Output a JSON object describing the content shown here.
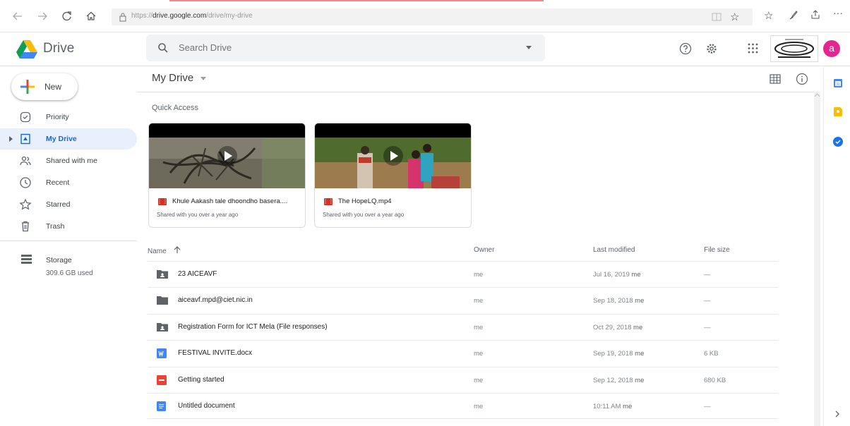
{
  "browser": {
    "url_prefix": "https://",
    "url_host": "drive.google.com",
    "url_path": "/drive/my-drive"
  },
  "header": {
    "app_title": "Drive",
    "search_placeholder": "Search Drive",
    "avatar_letter": "a"
  },
  "sidebar": {
    "new_label": "New",
    "items": [
      {
        "label": "Priority",
        "icon": "check-circle-icon"
      },
      {
        "label": "My Drive",
        "icon": "drive-folder-icon",
        "active": true
      },
      {
        "label": "Shared with me",
        "icon": "people-icon"
      },
      {
        "label": "Recent",
        "icon": "clock-icon"
      },
      {
        "label": "Starred",
        "icon": "star-icon"
      },
      {
        "label": "Trash",
        "icon": "trash-icon"
      }
    ],
    "storage_label": "Storage",
    "storage_used": "309.6 GB used"
  },
  "main": {
    "title": "My Drive",
    "quick_access_title": "Quick Access",
    "quick_access": [
      {
        "name": "Khule Aakash tale dhoondho basera....",
        "sub": "Shared with you over a year ago"
      },
      {
        "name": "The HopeLQ.mp4",
        "sub": "Shared with you over a year ago"
      }
    ],
    "columns": {
      "name": "Name",
      "owner": "Owner",
      "modified": "Last modified",
      "size": "File size"
    },
    "files": [
      {
        "name": "23 AICEAVF",
        "type": "shared-folder",
        "owner": "me",
        "modified": "Jul 16, 2019",
        "modified_by": "me",
        "size": "—"
      },
      {
        "name": "aiceavf.mpd@ciet.nic.in",
        "type": "folder",
        "owner": "me",
        "modified": "Sep 18, 2018",
        "modified_by": "me",
        "size": "—"
      },
      {
        "name": "Registration Form for ICT Mela (File responses)",
        "type": "shared-folder",
        "owner": "me",
        "modified": "Oct 29, 2018",
        "modified_by": "me",
        "size": "—"
      },
      {
        "name": "FESTIVAL INVITE.docx",
        "type": "word",
        "owner": "me",
        "modified": "Sep 19, 2018",
        "modified_by": "me",
        "size": "6 KB"
      },
      {
        "name": "Getting started",
        "type": "pdf",
        "owner": "me",
        "modified": "Sep 12, 2018",
        "modified_by": "me",
        "size": "680 KB"
      },
      {
        "name": "Untitled document",
        "type": "doc",
        "owner": "me",
        "modified": "10:11 AM",
        "modified_by": "me",
        "size": "—"
      }
    ]
  },
  "colors": {
    "accent": "#1a73e8",
    "active_bg": "#e8f0fe",
    "avatar": "#e52592",
    "pdf": "#ea4335",
    "word": "#4285f4"
  }
}
